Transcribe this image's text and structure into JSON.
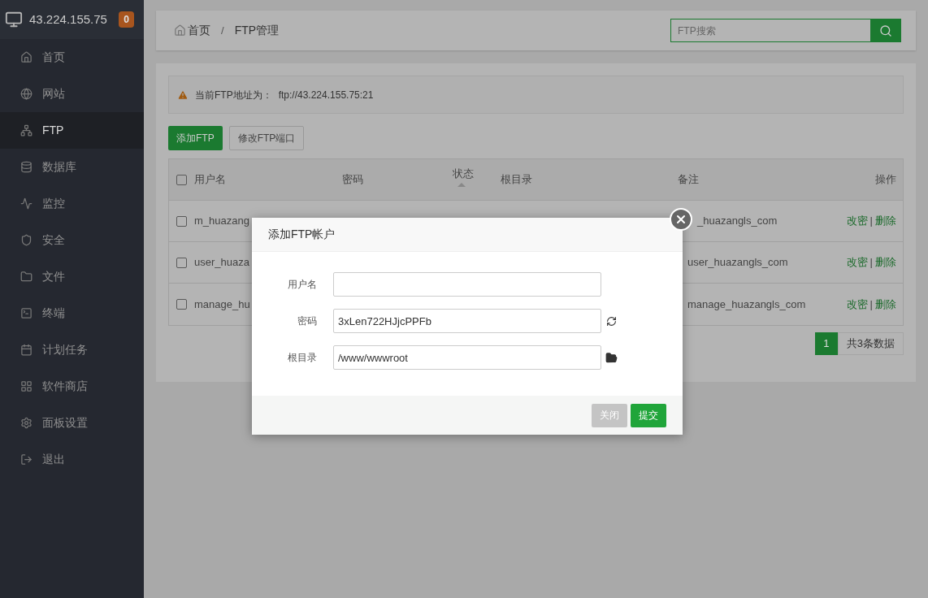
{
  "header": {
    "server": "43.224.155.75",
    "badge": "0"
  },
  "sidebar": {
    "items": [
      {
        "label": "首页",
        "selected": false
      },
      {
        "label": "网站",
        "selected": false
      },
      {
        "label": "FTP",
        "selected": true
      },
      {
        "label": "数据库",
        "selected": false
      },
      {
        "label": "监控",
        "selected": false
      },
      {
        "label": "安全",
        "selected": false
      },
      {
        "label": "文件",
        "selected": false
      },
      {
        "label": "终端",
        "selected": false
      },
      {
        "label": "计划任务",
        "selected": false
      },
      {
        "label": "软件商店",
        "selected": false
      },
      {
        "label": "面板设置",
        "selected": false
      },
      {
        "label": "退出",
        "selected": false
      }
    ]
  },
  "breadcrumb": {
    "items": [
      "首页",
      "FTP管理"
    ],
    "separator": "/"
  },
  "search": {
    "placeholder": "FTP搜索"
  },
  "alert": {
    "label": "当前FTP地址为：",
    "address": "ftp://43.224.155.75:21"
  },
  "buttons": [
    {
      "label": "添加FTP",
      "kind": "primary"
    },
    {
      "label": "修改FTP端口",
      "kind": "default"
    }
  ],
  "table": {
    "header_checked": false,
    "columns": [
      "用户名",
      "密码",
      "状态",
      "根目录",
      "备注",
      "操作"
    ],
    "rows": [
      {
        "checked": false,
        "username": "m_huazang",
        "note": "_huazangls_com",
        "actions": [
          "改密",
          "删除"
        ],
        "separator": "|"
      },
      {
        "checked": false,
        "username": "user_huaza",
        "note": "user_huazangls_com",
        "actions": [
          "改密",
          "删除"
        ],
        "separator": "|"
      },
      {
        "checked": false,
        "username": "manage_hu",
        "note": "manage_huazangls_com",
        "actions": [
          "改密",
          "删除"
        ],
        "separator": "|"
      }
    ]
  },
  "pagination": {
    "pages": [
      {
        "label": "1",
        "selected": true
      }
    ],
    "total": "共3条数据"
  },
  "modal": {
    "title": "添加FTP帐户",
    "fields": [
      {
        "label": "用户名",
        "kind": "text"
      },
      {
        "label": "密码",
        "value": "3xLen722HJjcPPFb",
        "kind": "generate"
      },
      {
        "label": "根目录",
        "value": "/www/wwwroot",
        "kind": "browse"
      }
    ],
    "buttons": [
      {
        "label": "关闭",
        "kind": "cancel"
      },
      {
        "label": "提交",
        "kind": "submit"
      }
    ]
  }
}
